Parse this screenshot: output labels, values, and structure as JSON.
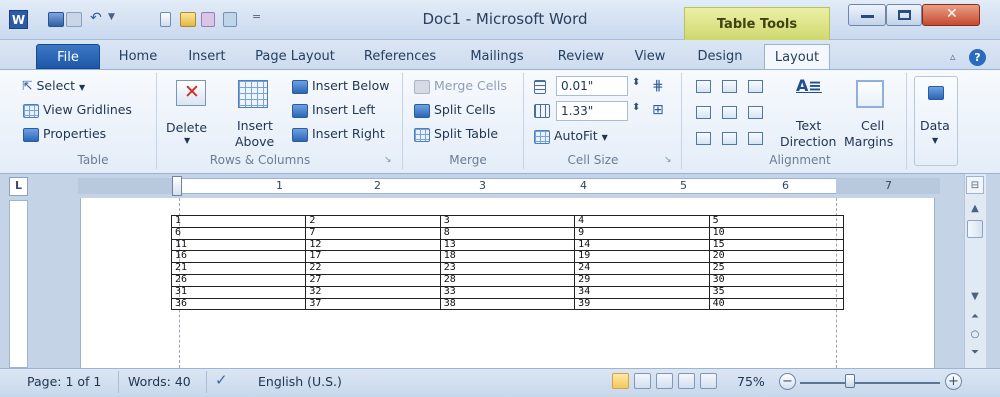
{
  "titlebar": {
    "app_icon": "W",
    "title": "Doc1 - Microsoft Word",
    "contextual_tab": "Table Tools"
  },
  "tabs": [
    "File",
    "Home",
    "Insert",
    "Page Layout",
    "References",
    "Mailings",
    "Review",
    "View",
    "Design",
    "Layout"
  ],
  "ribbon": {
    "table": {
      "select": "Select",
      "view_gridlines": "View Gridlines",
      "properties": "Properties",
      "label": "Table"
    },
    "rows_columns": {
      "delete": "Delete",
      "insert_above_1": "Insert",
      "insert_above_2": "Above",
      "insert_below": "Insert Below",
      "insert_left": "Insert Left",
      "insert_right": "Insert Right",
      "label": "Rows & Columns"
    },
    "merge": {
      "merge_cells": "Merge Cells",
      "split_cells": "Split Cells",
      "split_table": "Split Table",
      "label": "Merge"
    },
    "cell_size": {
      "height": "0.01\"",
      "width": "1.33\"",
      "autofit": "AutoFit",
      "label": "Cell Size"
    },
    "alignment": {
      "text_direction_1": "Text",
      "text_direction_2": "Direction",
      "cell_margins_1": "Cell",
      "cell_margins_2": "Margins",
      "label": "Alignment"
    },
    "data": {
      "label": "Data"
    }
  },
  "ruler_corner": "L",
  "ruler_numbers": [
    "1",
    "2",
    "3",
    "4",
    "5",
    "6",
    "7"
  ],
  "table_rows": [
    [
      "1",
      "2",
      "3",
      "4",
      "5"
    ],
    [
      "6",
      "7",
      "8",
      "9",
      "10"
    ],
    [
      "11",
      "12",
      "13",
      "14",
      "15"
    ],
    [
      "16",
      "17",
      "18",
      "19",
      "20"
    ],
    [
      "21",
      "22",
      "23",
      "24",
      "25"
    ],
    [
      "26",
      "27",
      "28",
      "29",
      "30"
    ],
    [
      "31",
      "32",
      "33",
      "34",
      "35"
    ],
    [
      "36",
      "37",
      "38",
      "39",
      "40"
    ]
  ],
  "statusbar": {
    "page": "Page: 1 of 1",
    "words": "Words: 40",
    "language": "English (U.S.)",
    "zoom": "75%"
  },
  "colors": {
    "file_tab": "#2a63b3",
    "contextual_tab": "#dbe38a",
    "close_button": "#c64a30"
  },
  "icons": [
    "word-app-icon",
    "save-icon",
    "undo-icon",
    "delete-icon",
    "insert-above-icon",
    "help-icon",
    "zoom-out-icon",
    "zoom-in-icon"
  ]
}
